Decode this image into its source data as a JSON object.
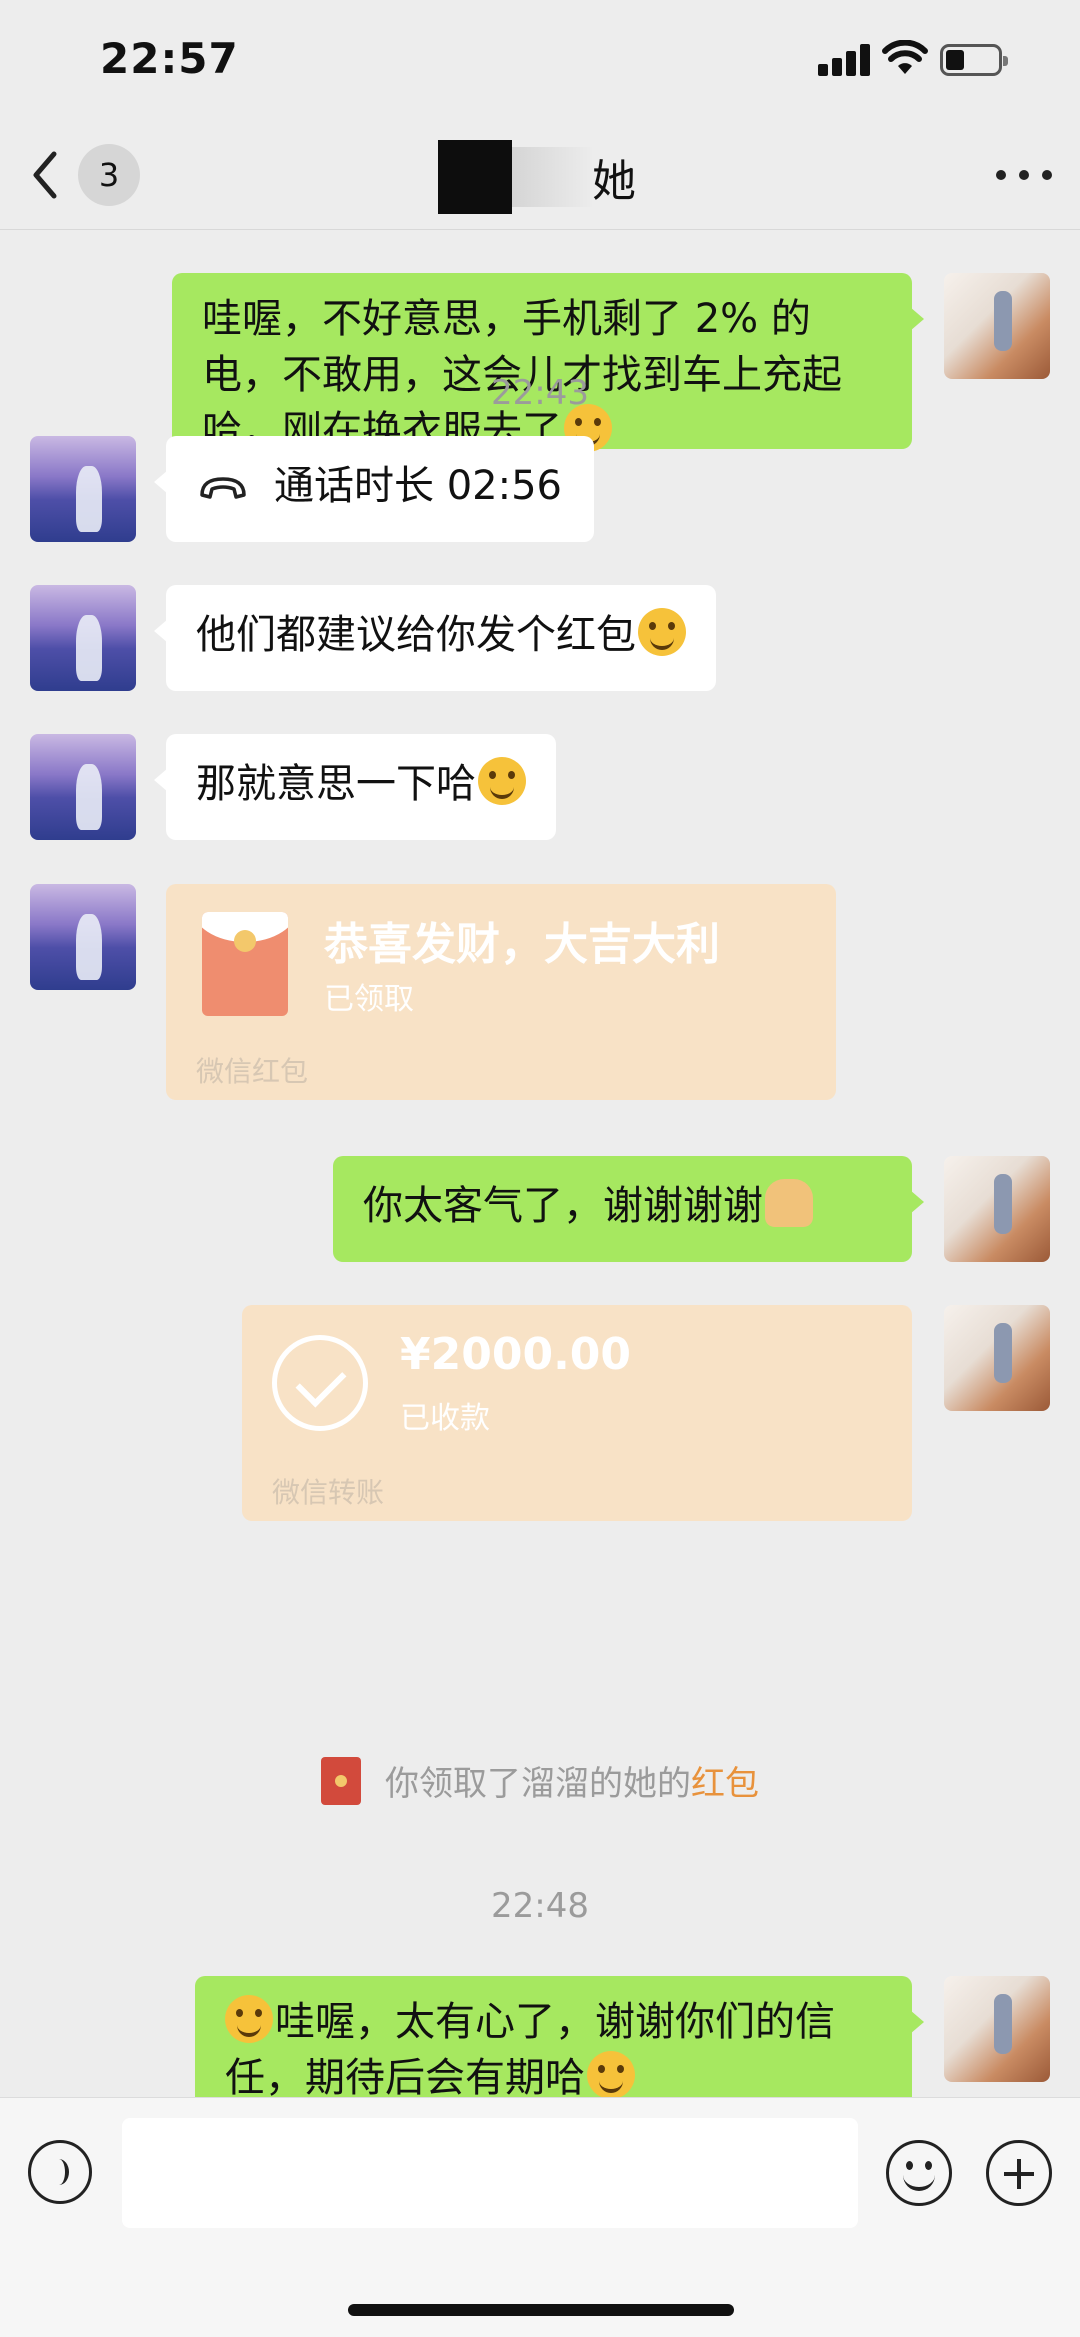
{
  "status_bar": {
    "time": "22:57"
  },
  "nav": {
    "unread_count": "3",
    "title_suffix": "她"
  },
  "messages": {
    "m1": {
      "text": "哇喔，不好意思，手机剩了 2% 的电，不敢用，这会儿才找到车上充起哈，刚在换衣服去了"
    },
    "ts1": "22:43",
    "call": {
      "text": "通话时长 02:56"
    },
    "m2": {
      "text": "他们都建议给你发个红包"
    },
    "m3": {
      "text": "那就意思一下哈"
    },
    "red_packet": {
      "title": "恭喜发财，大吉大利",
      "status": "已领取",
      "label": "微信红包"
    },
    "m4": {
      "text": "你太客气了，谢谢谢谢"
    },
    "transfer": {
      "amount": "¥2000.00",
      "status": "已收款",
      "label": "微信转账"
    },
    "system": {
      "prefix": "你领取了溜溜的她的",
      "link": "红包"
    },
    "ts2": "22:48",
    "m5": {
      "text": "哇喔，太有心了，谢谢你们的信任，期待后会有期哈"
    }
  },
  "icons": {
    "back": "chevron-left-icon",
    "more": "more-icon",
    "call": "phone-hangup-icon",
    "voice": "voice-icon",
    "emoji": "emoji-icon",
    "plus": "plus-icon"
  },
  "colors": {
    "my_bubble": "#a6e860",
    "their_bubble": "#ffffff",
    "card": "#f8e2c6",
    "link": "#e8923c"
  }
}
